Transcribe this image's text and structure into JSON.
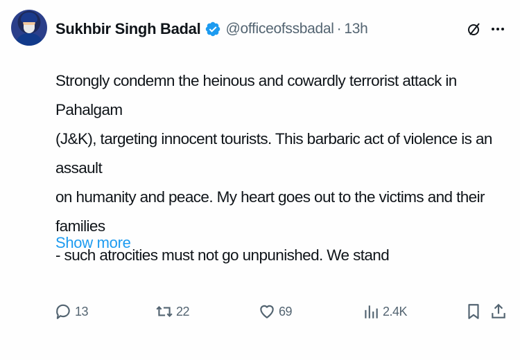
{
  "author": {
    "name": "Sukhbir Singh Badal",
    "handle": "@officeofssbadal",
    "separator": "·",
    "time": "13h"
  },
  "tweet": {
    "line1": "Strongly condemn the heinous and cowardly terrorist attack in Pahalgam",
    "line2": "(J&K), targeting innocent tourists. This barbaric act of violence is an assault",
    "line3": "on humanity and peace. My heart goes out to the victims and their families",
    "line4": "- such atrocities must not go unpunished. We stand",
    "show_more": "Show more"
  },
  "actions": {
    "replies": "13",
    "reposts": "22",
    "likes": "69",
    "views": "2.4K"
  },
  "icons": {
    "verified": "verified-badge-icon",
    "grok": "grok-icon",
    "more": "more-icon",
    "reply": "reply-icon",
    "repost": "repost-icon",
    "like": "heart-icon",
    "views": "views-icon",
    "bookmark": "bookmark-icon",
    "share": "share-icon"
  },
  "colors": {
    "accent": "#1d9bf0",
    "text": "#0f1419",
    "secondary": "#536471"
  }
}
